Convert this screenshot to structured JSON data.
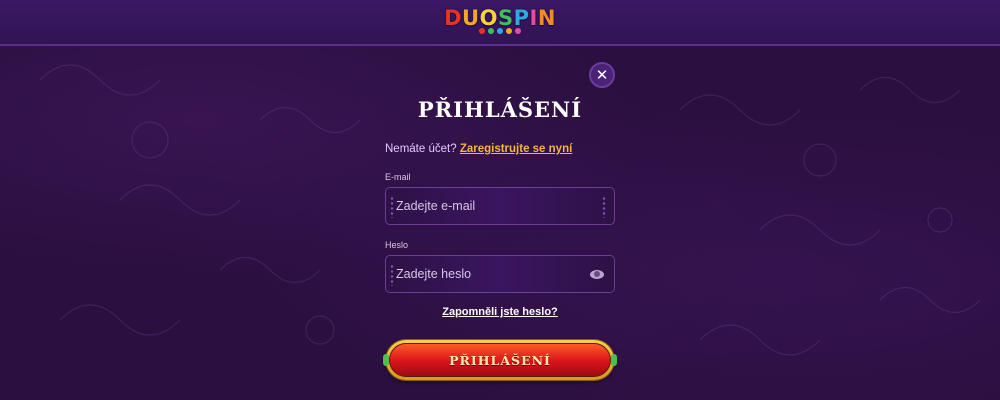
{
  "header": {
    "logo_text": "DUOSPIN",
    "logo_letters": [
      "D",
      "U",
      "O",
      "S",
      "P",
      "I",
      "N"
    ]
  },
  "modal": {
    "close_label": "✕",
    "title": "PŘIHLÁŠENÍ",
    "register_prompt": "Nemáte účet?",
    "register_link": "Zaregistrujte se nyní",
    "email_label": "E-mail",
    "email_placeholder": "Zadejte e-mail",
    "email_value": "",
    "password_label": "Heslo",
    "password_placeholder": "Zadejte heslo",
    "password_value": "",
    "forgot_link": "Zapomněli jste heslo?",
    "submit_label": "PŘIHLÁŠENÍ"
  },
  "colors": {
    "background": "#2b0f40",
    "header": "#3a1863",
    "accent_link": "#f6b63a",
    "button_red": "#d8141a",
    "button_gold": "#f3d24a"
  },
  "icons": {
    "close": "close-icon",
    "eye": "eye-icon"
  }
}
